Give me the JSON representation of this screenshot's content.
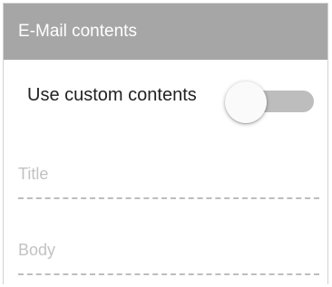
{
  "panel": {
    "header_title": "E-Mail contents"
  },
  "custom_contents": {
    "label": "Use custom contents",
    "toggle_state": "off"
  },
  "fields": {
    "title_placeholder": "Title",
    "body_placeholder": "Body"
  },
  "colors": {
    "header_bg": "#a6a6a6",
    "header_text": "#ffffff",
    "toggle_track": "#bdbdbd",
    "toggle_thumb": "#fafafa",
    "placeholder_text": "#c2c2c2",
    "dashed_line": "#bdbdbd"
  }
}
